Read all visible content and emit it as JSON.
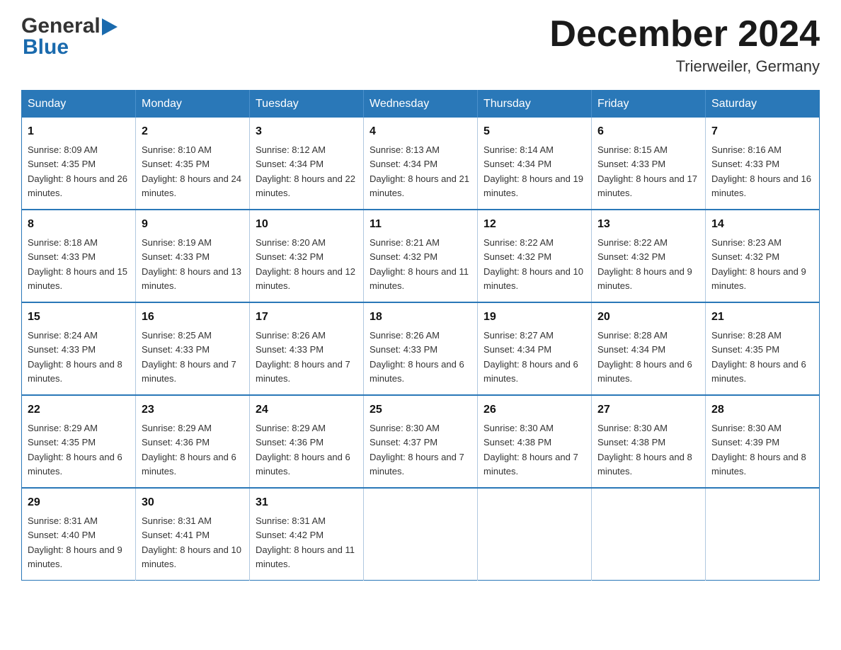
{
  "header": {
    "logo": {
      "general": "General",
      "blue": "Blue",
      "triangle": "▶"
    },
    "title": "December 2024",
    "location": "Trierweiler, Germany"
  },
  "calendar": {
    "weekdays": [
      "Sunday",
      "Monday",
      "Tuesday",
      "Wednesday",
      "Thursday",
      "Friday",
      "Saturday"
    ],
    "weeks": [
      [
        {
          "day": "1",
          "sunrise": "8:09 AM",
          "sunset": "4:35 PM",
          "daylight": "8 hours and 26 minutes."
        },
        {
          "day": "2",
          "sunrise": "8:10 AM",
          "sunset": "4:35 PM",
          "daylight": "8 hours and 24 minutes."
        },
        {
          "day": "3",
          "sunrise": "8:12 AM",
          "sunset": "4:34 PM",
          "daylight": "8 hours and 22 minutes."
        },
        {
          "day": "4",
          "sunrise": "8:13 AM",
          "sunset": "4:34 PM",
          "daylight": "8 hours and 21 minutes."
        },
        {
          "day": "5",
          "sunrise": "8:14 AM",
          "sunset": "4:34 PM",
          "daylight": "8 hours and 19 minutes."
        },
        {
          "day": "6",
          "sunrise": "8:15 AM",
          "sunset": "4:33 PM",
          "daylight": "8 hours and 17 minutes."
        },
        {
          "day": "7",
          "sunrise": "8:16 AM",
          "sunset": "4:33 PM",
          "daylight": "8 hours and 16 minutes."
        }
      ],
      [
        {
          "day": "8",
          "sunrise": "8:18 AM",
          "sunset": "4:33 PM",
          "daylight": "8 hours and 15 minutes."
        },
        {
          "day": "9",
          "sunrise": "8:19 AM",
          "sunset": "4:33 PM",
          "daylight": "8 hours and 13 minutes."
        },
        {
          "day": "10",
          "sunrise": "8:20 AM",
          "sunset": "4:32 PM",
          "daylight": "8 hours and 12 minutes."
        },
        {
          "day": "11",
          "sunrise": "8:21 AM",
          "sunset": "4:32 PM",
          "daylight": "8 hours and 11 minutes."
        },
        {
          "day": "12",
          "sunrise": "8:22 AM",
          "sunset": "4:32 PM",
          "daylight": "8 hours and 10 minutes."
        },
        {
          "day": "13",
          "sunrise": "8:22 AM",
          "sunset": "4:32 PM",
          "daylight": "8 hours and 9 minutes."
        },
        {
          "day": "14",
          "sunrise": "8:23 AM",
          "sunset": "4:32 PM",
          "daylight": "8 hours and 9 minutes."
        }
      ],
      [
        {
          "day": "15",
          "sunrise": "8:24 AM",
          "sunset": "4:33 PM",
          "daylight": "8 hours and 8 minutes."
        },
        {
          "day": "16",
          "sunrise": "8:25 AM",
          "sunset": "4:33 PM",
          "daylight": "8 hours and 7 minutes."
        },
        {
          "day": "17",
          "sunrise": "8:26 AM",
          "sunset": "4:33 PM",
          "daylight": "8 hours and 7 minutes."
        },
        {
          "day": "18",
          "sunrise": "8:26 AM",
          "sunset": "4:33 PM",
          "daylight": "8 hours and 6 minutes."
        },
        {
          "day": "19",
          "sunrise": "8:27 AM",
          "sunset": "4:34 PM",
          "daylight": "8 hours and 6 minutes."
        },
        {
          "day": "20",
          "sunrise": "8:28 AM",
          "sunset": "4:34 PM",
          "daylight": "8 hours and 6 minutes."
        },
        {
          "day": "21",
          "sunrise": "8:28 AM",
          "sunset": "4:35 PM",
          "daylight": "8 hours and 6 minutes."
        }
      ],
      [
        {
          "day": "22",
          "sunrise": "8:29 AM",
          "sunset": "4:35 PM",
          "daylight": "8 hours and 6 minutes."
        },
        {
          "day": "23",
          "sunrise": "8:29 AM",
          "sunset": "4:36 PM",
          "daylight": "8 hours and 6 minutes."
        },
        {
          "day": "24",
          "sunrise": "8:29 AM",
          "sunset": "4:36 PM",
          "daylight": "8 hours and 6 minutes."
        },
        {
          "day": "25",
          "sunrise": "8:30 AM",
          "sunset": "4:37 PM",
          "daylight": "8 hours and 7 minutes."
        },
        {
          "day": "26",
          "sunrise": "8:30 AM",
          "sunset": "4:38 PM",
          "daylight": "8 hours and 7 minutes."
        },
        {
          "day": "27",
          "sunrise": "8:30 AM",
          "sunset": "4:38 PM",
          "daylight": "8 hours and 8 minutes."
        },
        {
          "day": "28",
          "sunrise": "8:30 AM",
          "sunset": "4:39 PM",
          "daylight": "8 hours and 8 minutes."
        }
      ],
      [
        {
          "day": "29",
          "sunrise": "8:31 AM",
          "sunset": "4:40 PM",
          "daylight": "8 hours and 9 minutes."
        },
        {
          "day": "30",
          "sunrise": "8:31 AM",
          "sunset": "4:41 PM",
          "daylight": "8 hours and 10 minutes."
        },
        {
          "day": "31",
          "sunrise": "8:31 AM",
          "sunset": "4:42 PM",
          "daylight": "8 hours and 11 minutes."
        },
        null,
        null,
        null,
        null
      ]
    ]
  }
}
